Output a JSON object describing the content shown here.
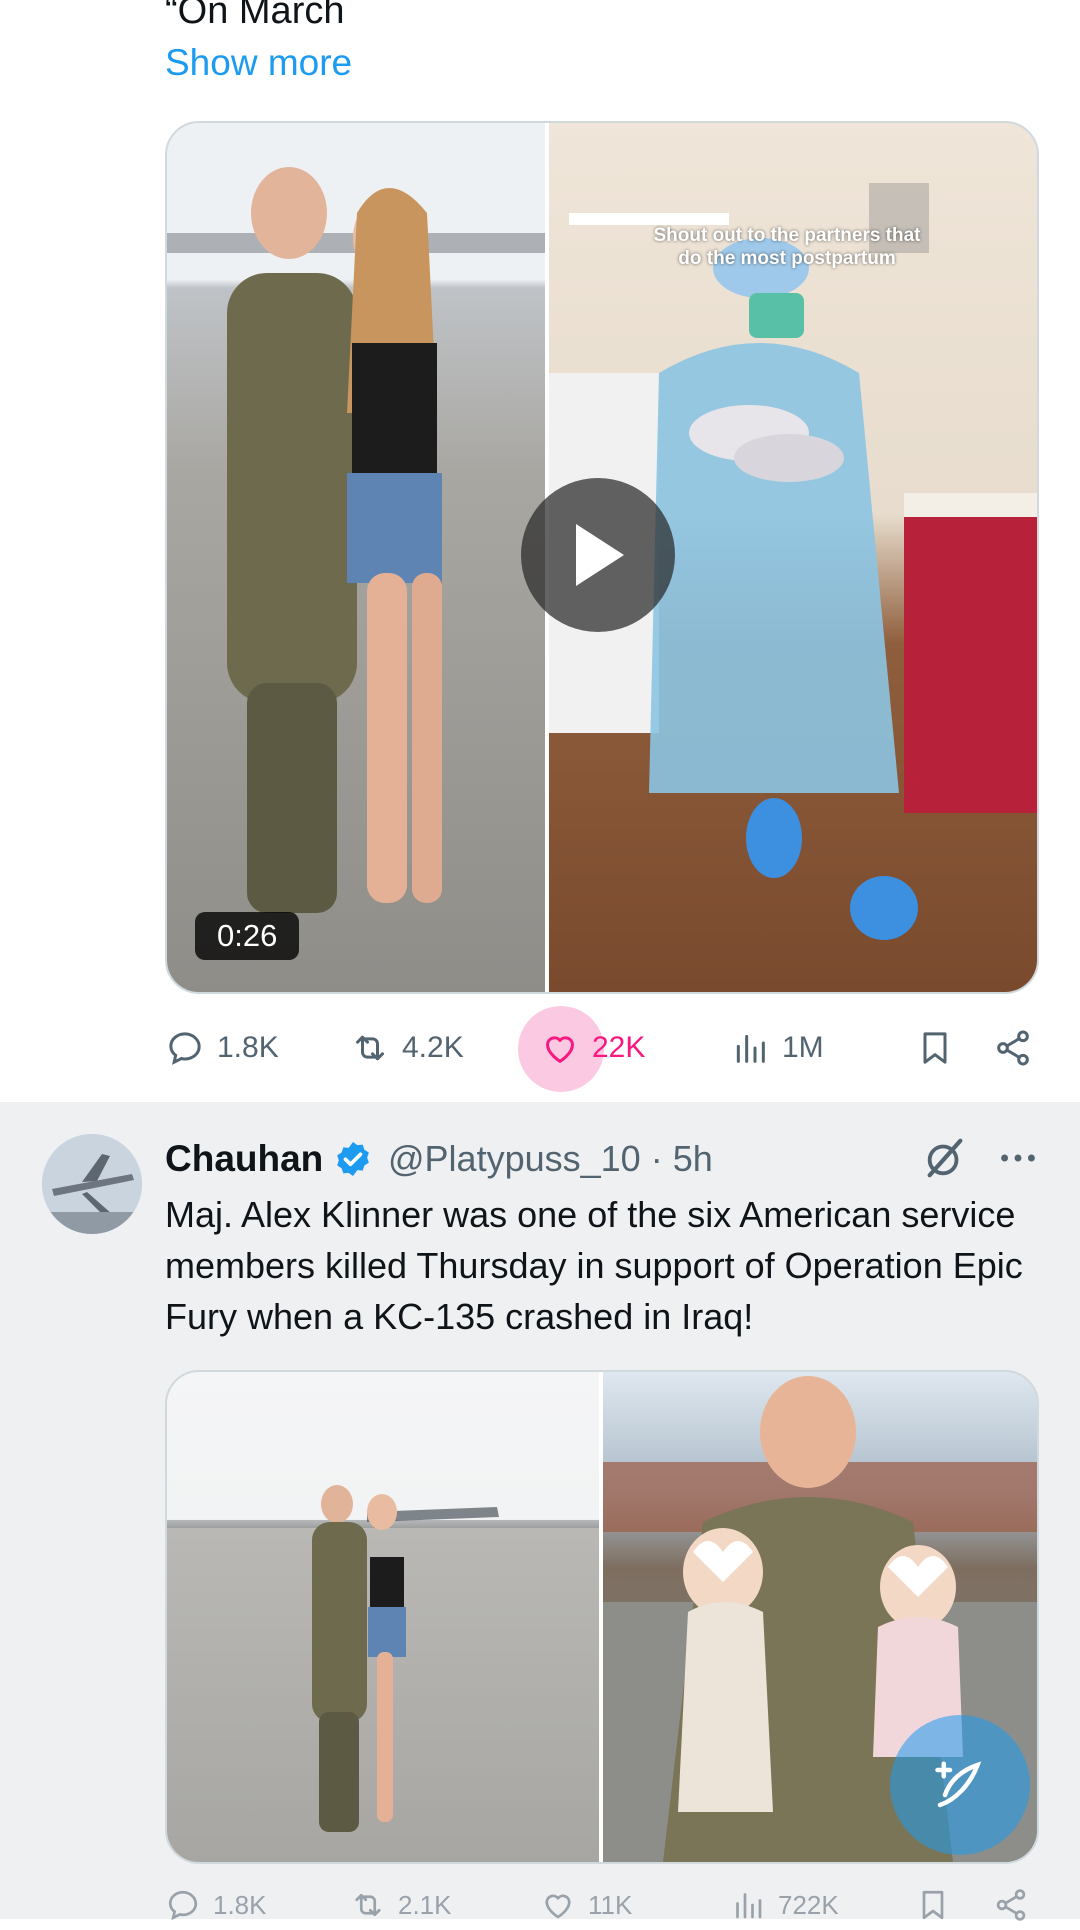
{
  "tweet1": {
    "text_fragment": "“On March",
    "show_more": "Show more",
    "video": {
      "duration": "0:26",
      "overlay_caption_line1": "Shout out to the partners that",
      "overlay_caption_line2": "do the most postpartum"
    },
    "actions": {
      "replies": "1.8K",
      "reposts": "4.2K",
      "likes": "22K",
      "views": "1M"
    }
  },
  "tweet2": {
    "author_name": "Chauhan",
    "handle": "@Platypuss_10",
    "separator": "·",
    "time": "5h",
    "text": "Maj. Alex Klinner was one of the six American service members killed Thursday in support of Operation Epic Fury when a KC-135 crashed in Iraq!",
    "actions": {
      "replies": "1.8K",
      "reposts": "2.1K",
      "likes": "11K",
      "views": "722K"
    }
  },
  "colors": {
    "accent": "#1d9bf0",
    "like": "#f91880",
    "muted": "#536471",
    "verified": "#1d9bf0"
  }
}
